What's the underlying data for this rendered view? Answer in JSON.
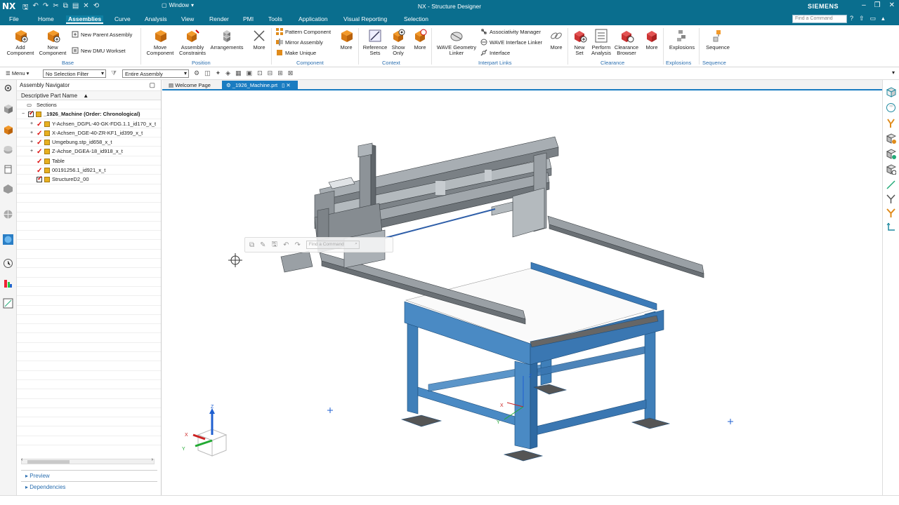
{
  "titlebar": {
    "app": "NX",
    "window_menu": "Window",
    "title": "NX - Structure Designer",
    "brand": "SIEMENS"
  },
  "menubar": {
    "items": [
      "File",
      "Home",
      "Assemblies",
      "Curve",
      "Analysis",
      "View",
      "Render",
      "PMI",
      "Tools",
      "Application",
      "Visual Reporting",
      "Selection"
    ],
    "active": "Assemblies",
    "search_placeholder": "Find a Command"
  },
  "ribbon": {
    "base": {
      "add_component": "Add\nComponent",
      "new_component": "New\nComponent",
      "new_parent_assembly": "New Parent Assembly",
      "new_dmu_workset": "New DMU Workset",
      "group": "Base"
    },
    "position": {
      "move_component": "Move\nComponent",
      "assembly_constraints": "Assembly\nConstraints",
      "arrangements": "Arrangements",
      "more": "More",
      "group": "Position"
    },
    "component": {
      "pattern_component": "Pattern Component",
      "mirror_assembly": "Mirror Assembly",
      "make_unique": "Make Unique",
      "more": "More",
      "group": "Component"
    },
    "context": {
      "reference_sets": "Reference\nSets",
      "show_only": "Show\nOnly",
      "more": "More",
      "group": "Context"
    },
    "interpart": {
      "wave_geometry_linker": "WAVE Geometry\nLinker",
      "associativity_manager": "Associativity Manager",
      "wave_interface_linker": "WAVE Interface Linker",
      "interface": "Interface",
      "more": "More",
      "group": "Interpart Links"
    },
    "clearance": {
      "new_set": "New\nSet",
      "perform_analysis": "Perform\nAnalysis",
      "clearance_browser": "Clearance\nBrowser",
      "more": "More",
      "group": "Clearance"
    },
    "explosions": {
      "label": "Explosions",
      "group": "Explosions"
    },
    "sequence": {
      "label": "Sequence",
      "group": "Sequence"
    }
  },
  "toolbar2": {
    "menu": "Menu",
    "selection_filter": "No Selection Filter",
    "scope": "Entire Assembly"
  },
  "navigator": {
    "title": "Assembly Navigator",
    "column": "Descriptive Part Name",
    "rows": [
      {
        "label": "Sections",
        "level": 0,
        "type": "folder"
      },
      {
        "label": "_1926_Machine (Order: Chronological)",
        "level": 0,
        "type": "root"
      },
      {
        "label": "Y-Achsen_DGPL-40-GK-FDG.1.1_id170_x_t",
        "level": 1,
        "type": "sub"
      },
      {
        "label": "X-Achsen_DGE-40-ZR-KF1_id399_x_t",
        "level": 1,
        "type": "sub"
      },
      {
        "label": "Umgebung.stp_id658_x_t",
        "level": 1,
        "type": "sub"
      },
      {
        "label": "Z-Achse_DGEA-18_id918_x_t",
        "level": 1,
        "type": "sub"
      },
      {
        "label": "Table",
        "level": 1,
        "type": "part"
      },
      {
        "label": "00191256.1_id921_x_t",
        "level": 1,
        "type": "part"
      },
      {
        "label": "StructureD2_00",
        "level": 1,
        "type": "box"
      }
    ],
    "preview": "Preview",
    "dependencies": "Dependencies"
  },
  "tabs": [
    {
      "label": "Welcome Page"
    },
    {
      "label": "_1926_Machine.prt"
    }
  ],
  "minitoolbar": {
    "search_placeholder": "Find a Command"
  },
  "triad": {
    "x": "X",
    "y": "Y",
    "z": "Z"
  },
  "colors": {
    "accent": "#0a6e8e",
    "frame_blue": "#3f7fb9",
    "rail_gray": "#8c9196"
  }
}
